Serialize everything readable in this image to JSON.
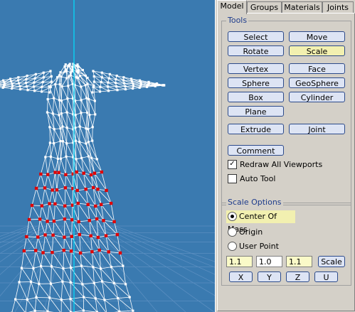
{
  "tabs": [
    "Model",
    "Groups",
    "Materials",
    "Joints"
  ],
  "tools": {
    "legend": "Tools",
    "select": "Select",
    "move": "Move",
    "rotate": "Rotate",
    "scale": "Scale",
    "vertex": "Vertex",
    "face": "Face",
    "sphere": "Sphere",
    "geosphere": "GeoSphere",
    "box": "Box",
    "cylinder": "Cylinder",
    "plane": "Plane",
    "extrude": "Extrude",
    "joint": "Joint",
    "comment": "Comment",
    "redraw_all": "Redraw All Viewports",
    "redraw_checked": true,
    "auto_tool": "Auto Tool",
    "auto_checked": false
  },
  "scale_options": {
    "legend": "Scale Options",
    "center_of_mass": "Center Of Mass",
    "origin": "Origin",
    "user_point": "User Point",
    "selected": "Center Of Mass",
    "x_value": "1.1",
    "y_value": "1.0",
    "z_value": "1.1",
    "scale_button": "Scale",
    "x_button": "X",
    "y_button": "Y",
    "z_button": "Z",
    "u_button": "U"
  },
  "colors": {
    "viewport_bg": "#3a7ab0",
    "wire": "#ffffff",
    "selected_vertex": "#e00000",
    "axis": "#00e0ff",
    "highlight": "#f2f0b0"
  }
}
